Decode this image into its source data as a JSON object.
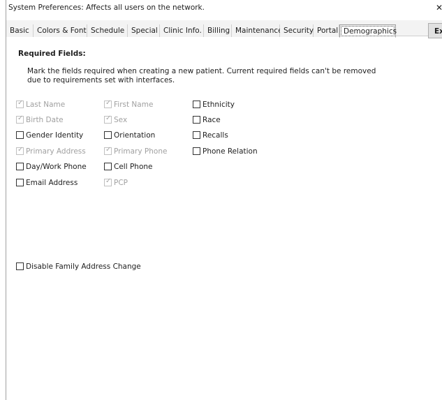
{
  "window": {
    "title": "System Preferences: Affects all users on the network.",
    "close_glyph": "✕"
  },
  "tabs": [
    {
      "label": "Basic"
    },
    {
      "label": "Colors & Font"
    },
    {
      "label": "Schedule"
    },
    {
      "label": "Special"
    },
    {
      "label": "Clinic Info."
    },
    {
      "label": "Billing"
    },
    {
      "label": "Maintenance"
    },
    {
      "label": "Security"
    },
    {
      "label": "Portal"
    },
    {
      "label": "Demographics",
      "active": true
    }
  ],
  "exit_button": {
    "label": "Exit"
  },
  "required_fields": {
    "heading": "Required Fields:",
    "description": "Mark the fields required when creating a new patient. Current required fields can't be removed due to requirements set with interfaces.",
    "checkboxes": [
      {
        "label": "Last Name",
        "checked": true,
        "disabled": true
      },
      {
        "label": "First Name",
        "checked": true,
        "disabled": true
      },
      {
        "label": "Ethnicity",
        "checked": false,
        "disabled": false
      },
      {
        "label": "Birth Date",
        "checked": true,
        "disabled": true
      },
      {
        "label": "Sex",
        "checked": true,
        "disabled": true
      },
      {
        "label": "Race",
        "checked": false,
        "disabled": false
      },
      {
        "label": "Gender Identity",
        "checked": false,
        "disabled": false
      },
      {
        "label": "Orientation",
        "checked": false,
        "disabled": false
      },
      {
        "label": "Recalls",
        "checked": false,
        "disabled": false
      },
      {
        "label": "Primary Address",
        "checked": true,
        "disabled": true
      },
      {
        "label": "Primary Phone",
        "checked": true,
        "disabled": true
      },
      {
        "label": "Phone Relation",
        "checked": false,
        "disabled": false
      },
      {
        "label": "Day/Work Phone",
        "checked": false,
        "disabled": false
      },
      {
        "label": "Cell Phone",
        "checked": false,
        "disabled": false
      },
      {
        "label": "Email Address",
        "checked": false,
        "disabled": false
      },
      {
        "label": "PCP",
        "checked": true,
        "disabled": true
      }
    ]
  },
  "family_address": {
    "label": "Disable Family Address Change",
    "checked": false
  },
  "colors": {
    "disabled_text": "#a0a0a0",
    "active_tab_border": "#9a9a9a"
  }
}
